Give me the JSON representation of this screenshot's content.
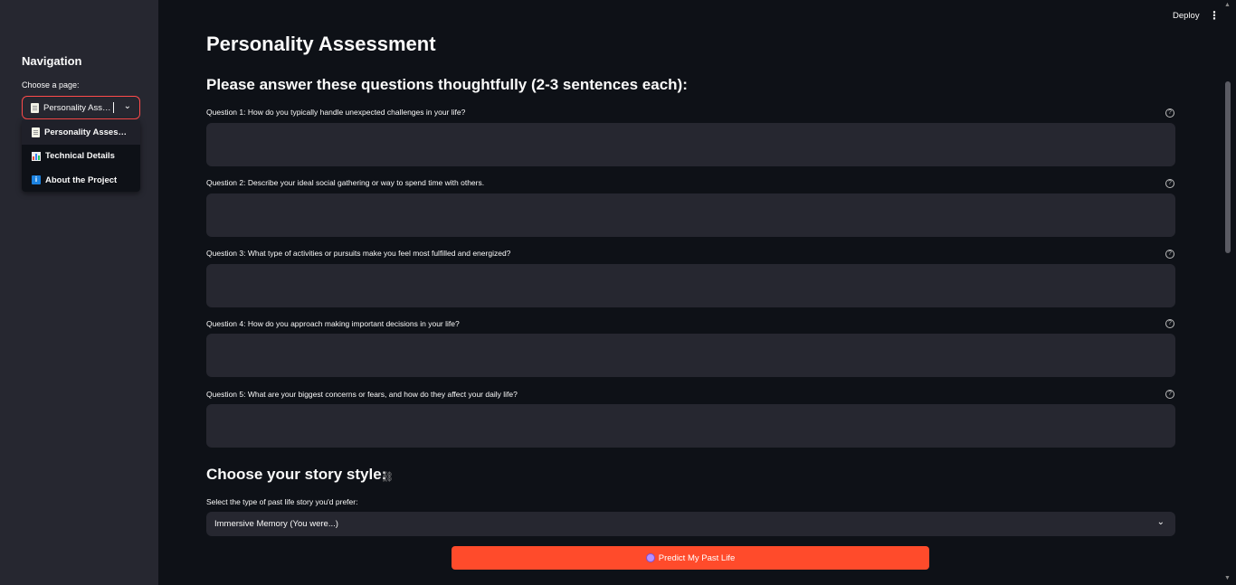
{
  "sidebar": {
    "title": "Navigation",
    "select_label": "Choose a page:",
    "selected": "Personality Assessment",
    "options": [
      {
        "label": "Personality Assessment",
        "icon": "page-icon"
      },
      {
        "label": "Technical Details",
        "icon": "chart-icon"
      },
      {
        "label": "About the Project",
        "icon": "info-icon"
      }
    ]
  },
  "topbar": {
    "deploy_label": "Deploy",
    "menu_icon": "⋮"
  },
  "main": {
    "title": "Personality Assessment",
    "subheader": "Please answer these questions thoughtfully (2-3 sentences each):",
    "questions": [
      {
        "label": "Question 1: How do you typically handle unexpected challenges in your life?",
        "value": ""
      },
      {
        "label": "Question 2: Describe your ideal social gathering or way to spend time with others.",
        "value": ""
      },
      {
        "label": "Question 3: What type of activities or pursuits make you feel most fulfilled and energized?",
        "value": ""
      },
      {
        "label": "Question 4: How do you approach making important decisions in your life?",
        "value": ""
      },
      {
        "label": "Question 5: What are your biggest concerns or fears, and how do they affect your daily life?",
        "value": ""
      }
    ],
    "story_title": "Choose your story style:",
    "story_select_label": "Select the type of past life story you'd prefer:",
    "story_selected": "Immersive Memory (You were...)",
    "predict_label": "Predict My Past Life"
  },
  "colors": {
    "accent": "#ff4b4b",
    "button": "#ff4b2b",
    "background": "#0e1117",
    "sidebar": "#262730"
  }
}
